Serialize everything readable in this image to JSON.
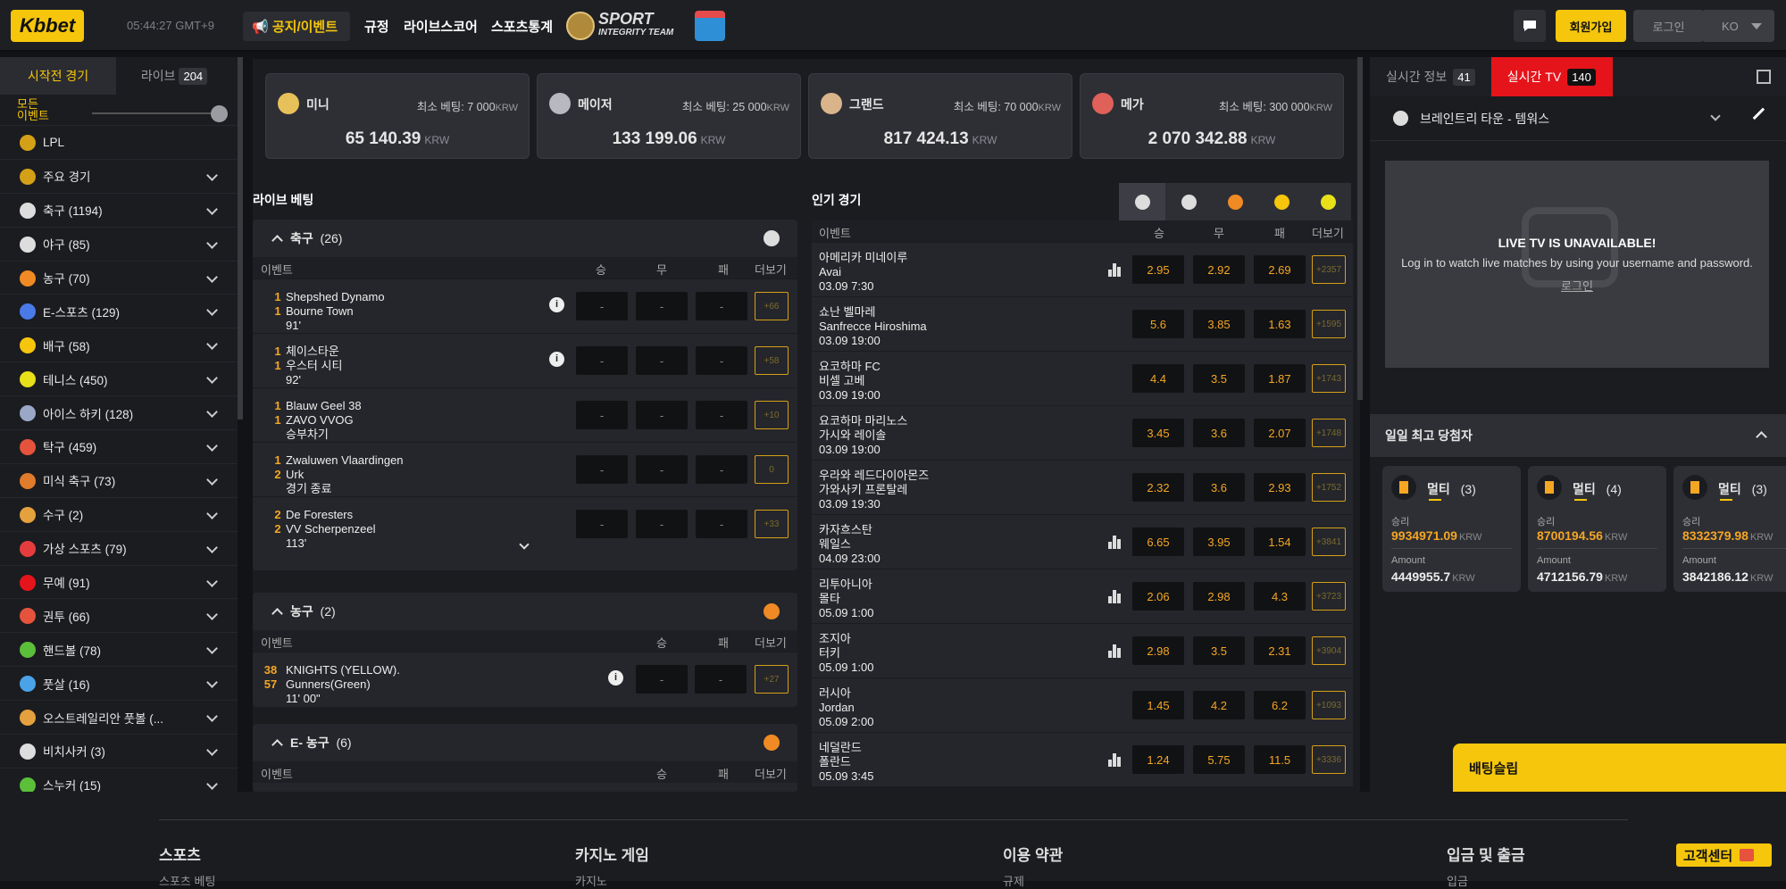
{
  "header": {
    "logo": "Kbbet",
    "time": "05:44:27",
    "tz": "GMT+9",
    "nav": [
      "📢 공지/이벤트",
      "규정",
      "라이브스코어",
      "스포츠통계"
    ],
    "si_main": "SPORT",
    "si_sub": "INTEGRITY TEAM",
    "join": "회원가입",
    "login": "로그인",
    "lang": "KO"
  },
  "sidebar": {
    "tabs": [
      {
        "label": "시작전 경기"
      },
      {
        "label": "라이브",
        "count": "204"
      }
    ],
    "all_events": "모든 이벤트",
    "all_events_l1": "모든",
    "all_events_l2": "이벤트",
    "items": [
      {
        "label": "LPL",
        "icon": "trophy-icon",
        "color": "#d4a017",
        "chev": false
      },
      {
        "label": "주요 경기",
        "icon": "podium-icon",
        "color": "#d4a017",
        "chev": true
      },
      {
        "label": "축구 (1194)",
        "icon": "soccer-icon",
        "color": "#dddddd",
        "chev": true
      },
      {
        "label": "야구 (85)",
        "icon": "baseball-icon",
        "color": "#dddddd",
        "chev": true
      },
      {
        "label": "농구 (70)",
        "icon": "basketball-icon",
        "color": "#f08a24",
        "chev": true
      },
      {
        "label": "E-스포츠 (129)",
        "icon": "gamepad-icon",
        "color": "#4a79e8",
        "chev": true
      },
      {
        "label": "배구 (58)",
        "icon": "volleyball-icon",
        "color": "#f5c60b",
        "chev": true
      },
      {
        "label": "테니스 (450)",
        "icon": "tennis-icon",
        "color": "#e8e11a",
        "chev": true
      },
      {
        "label": "아이스 하키 (128)",
        "icon": "puck-icon",
        "color": "#9aa7c7",
        "chev": true
      },
      {
        "label": "탁구 (459)",
        "icon": "pingpong-icon",
        "color": "#e5533d",
        "chev": true
      },
      {
        "label": "미식 축구 (73)",
        "icon": "football-icon",
        "color": "#e07b2b",
        "chev": true
      },
      {
        "label": "수구 (2)",
        "icon": "waterpolo-icon",
        "color": "#e5a13d",
        "chev": true
      },
      {
        "label": "가상 스포츠 (79)",
        "icon": "virtual-icon",
        "color": "#e53d3d",
        "chev": true
      },
      {
        "label": "무예 (91)",
        "icon": "martial-icon",
        "color": "#e5141b",
        "chev": true
      },
      {
        "label": "권투 (66)",
        "icon": "boxing-icon",
        "color": "#e5533d",
        "chev": true
      },
      {
        "label": "핸드볼 (78)",
        "icon": "handball-icon",
        "color": "#5bbf3a",
        "chev": true
      },
      {
        "label": "풋살 (16)",
        "icon": "futsal-icon",
        "color": "#4aa3e8",
        "chev": true
      },
      {
        "label": "오스트레일리안 풋볼 (...",
        "icon": "aussie-football-icon",
        "color": "#e5a13d",
        "chev": true
      },
      {
        "label": "비치사커 (3)",
        "icon": "beach-soccer-icon",
        "color": "#dddddd",
        "chev": true
      },
      {
        "label": "스누커 (15)",
        "icon": "snooker-icon",
        "color": "#5bbf3a",
        "chev": true
      }
    ]
  },
  "jackpots": [
    {
      "name": "미니",
      "min": "최소 베팅: 7 000",
      "amount": "65 140.39",
      "cur": "KRW",
      "color": "#e6c15a"
    },
    {
      "name": "메이저",
      "min": "최소 베팅: 25 000",
      "amount": "133 199.06",
      "cur": "KRW",
      "color": "#b8b8c0"
    },
    {
      "name": "그랜드",
      "min": "최소 베팅: 70 000",
      "amount": "817 424.13",
      "cur": "KRW",
      "color": "#d9b48a"
    },
    {
      "name": "메가",
      "min": "최소 베팅: 300 000",
      "amount": "2 070 342.88",
      "cur": "KRW",
      "color": "#e0605a"
    }
  ],
  "live": {
    "title": "라이브 베팅",
    "soccer": {
      "label": "축구",
      "count": "(26)",
      "cols": [
        "이벤트",
        "승",
        "무",
        "패",
        "더보기"
      ],
      "rows": [
        {
          "s1": "1",
          "s2": "1",
          "t1": "Shepshed Dynamo",
          "t2": "Bourne Town",
          "st": "91'",
          "more": "+66",
          "info": true
        },
        {
          "s1": "1",
          "s2": "1",
          "t1": "체이스타운",
          "t2": "우스터 시티",
          "st": "92'",
          "more": "+58",
          "info": true
        },
        {
          "s1": "1",
          "s2": "1",
          "t1": "Blauw Geel 38",
          "t2": "ZAVO VVOG",
          "st": "승부차기",
          "more": "+10",
          "info": false
        },
        {
          "s1": "1",
          "s2": "2",
          "t1": "Zwaluwen Vlaardingen",
          "t2": "Urk",
          "st": "경기 종료",
          "more": "0",
          "info": false
        },
        {
          "s1": "2",
          "s2": "2",
          "t1": "De Foresters",
          "t2": "VV Scherpenzeel",
          "st": "113'",
          "more": "+33",
          "info": false
        }
      ],
      "dash": "-"
    },
    "basket": {
      "label": "농구",
      "count": "(2)",
      "cols": [
        "이벤트",
        "승",
        "패",
        "더보기"
      ],
      "rows": [
        {
          "s1": "38",
          "s2": "57",
          "t1": "KNIGHTS (YELLOW).",
          "t2": "Gunners(Green)",
          "st": "11' 00\"",
          "more": "+27"
        }
      ]
    },
    "ebasket": {
      "label": "E- 농구",
      "count": "(6)",
      "cols": [
        "이벤트",
        "승",
        "패",
        "더보기"
      ]
    }
  },
  "popular": {
    "title": "인기 경기",
    "cols": [
      "이벤트",
      "승",
      "무",
      "패",
      "더보기"
    ],
    "tabs": [
      "soccer-icon",
      "baseball-icon",
      "basketball-icon",
      "volleyball-icon",
      "tennis-icon"
    ],
    "rows": [
      {
        "t1": "아메리카 미네이루",
        "t2": "Avai",
        "d": "03.09 7:30",
        "o": [
          "2.95",
          "2.92",
          "2.69"
        ],
        "more": "+2357",
        "stats": true
      },
      {
        "t1": "쇼난 벨마레",
        "t2": "Sanfrecce Hiroshima",
        "d": "03.09 19:00",
        "o": [
          "5.6",
          "3.85",
          "1.63"
        ],
        "more": "+1595",
        "stats": false
      },
      {
        "t1": "요코하마 FC",
        "t2": "비셀 고베",
        "d": "03.09 19:00",
        "o": [
          "4.4",
          "3.5",
          "1.87"
        ],
        "more": "+1743",
        "stats": false
      },
      {
        "t1": "요코하마 마리노스",
        "t2": "가시와 레이솔",
        "d": "03.09 19:00",
        "o": [
          "3.45",
          "3.6",
          "2.07"
        ],
        "more": "+1748",
        "stats": false
      },
      {
        "t1": "우라와 레드다이아몬즈",
        "t2": "가와사키 프론탈레",
        "d": "03.09 19:30",
        "o": [
          "2.32",
          "3.6",
          "2.93"
        ],
        "more": "+1752",
        "stats": false
      },
      {
        "t1": "카자흐스탄",
        "t2": "웨일스",
        "d": "04.09 23:00",
        "o": [
          "6.65",
          "3.95",
          "1.54"
        ],
        "more": "+3841",
        "stats": true
      },
      {
        "t1": "리투아니아",
        "t2": "몰타",
        "d": "05.09 1:00",
        "o": [
          "2.06",
          "2.98",
          "4.3"
        ],
        "more": "+3723",
        "stats": true
      },
      {
        "t1": "조지아",
        "t2": "터키",
        "d": "05.09 1:00",
        "o": [
          "2.98",
          "3.5",
          "2.31"
        ],
        "more": "+3904",
        "stats": true
      },
      {
        "t1": "러시아",
        "t2": "Jordan",
        "d": "05.09 2:00",
        "o": [
          "1.45",
          "4.2",
          "6.2"
        ],
        "more": "+1093",
        "stats": false
      },
      {
        "t1": "네덜란드",
        "t2": "폴란드",
        "d": "05.09 3:45",
        "o": [
          "1.24",
          "5.75",
          "11.5"
        ],
        "more": "+3336",
        "stats": true
      }
    ]
  },
  "right": {
    "tabs": [
      {
        "label": "실시간 정보",
        "count": "41"
      },
      {
        "label": "실시간 TV",
        "count": "140"
      }
    ],
    "match": "브레인트리 타운 - 템워스",
    "tv_title": "LIVE TV IS UNAVAILABLE!",
    "tv_msg": "Log in to watch live matches by using your username and password.",
    "tv_login": "로그인",
    "winners_title": "일일 최고 당첨자",
    "winners": [
      {
        "title": "멀티",
        "n": "(3)",
        "win_label": "승리",
        "win": "9934971.09",
        "amount_label": "Amount",
        "amount": "4449955.7",
        "cur": "KRW"
      },
      {
        "title": "멀티",
        "n": "(4)",
        "win_label": "승리",
        "win": "8700194.56",
        "amount_label": "Amount",
        "amount": "4712156.79",
        "cur": "KRW"
      },
      {
        "title": "멀티",
        "n": "(3)",
        "win_label": "승리",
        "win": "8332379.98",
        "amount_label": "Amount",
        "amount": "3842186.12",
        "cur": "KRW"
      }
    ]
  },
  "betslip": "배팅슬립",
  "footer": {
    "cols": [
      {
        "title": "스포츠",
        "sub": "스포츠 베팅"
      },
      {
        "title": "카지노 게임",
        "sub": "카지노"
      },
      {
        "title": "이용 약관",
        "sub": "규제"
      },
      {
        "title": "입금 및 출금",
        "sub": "입금"
      }
    ],
    "cs": "고객센터"
  }
}
